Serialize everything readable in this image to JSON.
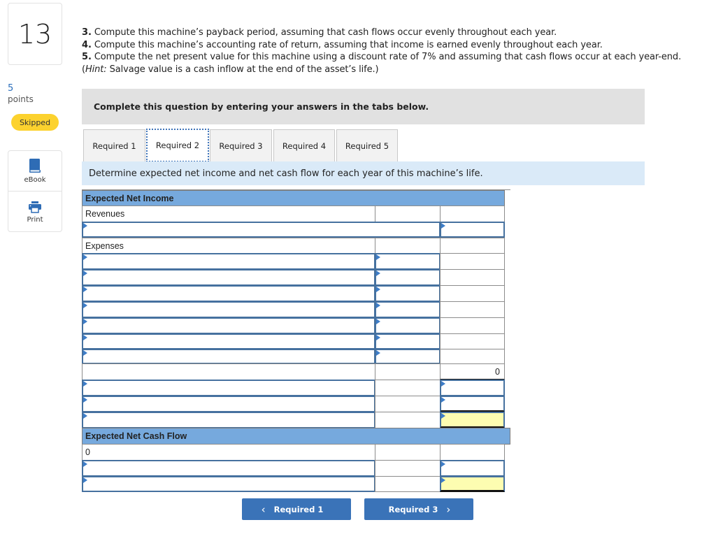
{
  "sidebar": {
    "question_number": "13",
    "points_value": "5",
    "points_label": "points",
    "status_badge": "Skipped",
    "tools": [
      {
        "label": "eBook",
        "icon": "book-icon"
      },
      {
        "label": "Print",
        "icon": "printer-icon"
      }
    ]
  },
  "questions": {
    "q3_num": "3.",
    "q3_text": " Compute this machine’s payback period, assuming that cash flows occur evenly throughout each year.",
    "q4_num": "4.",
    "q4_text": " Compute this machine’s accounting rate of return, assuming that income is earned evenly throughout each year.",
    "q5_num": "5.",
    "q5_text": " Compute the net present value for this machine using a discount rate of 7% and assuming that cash flows occur at each year-end.",
    "hint_open": "(",
    "hint_label": "Hint:",
    "hint_text": " Salvage value is a cash inflow at the end of the asset’s life.)"
  },
  "instructions": "Complete this question by entering your answers in the tabs below.",
  "tabs": [
    {
      "label": "Required 1",
      "active": false
    },
    {
      "label": "Required 2",
      "active": true
    },
    {
      "label": "Required 3",
      "active": false
    },
    {
      "label": "Required 4",
      "active": false
    },
    {
      "label": "Required 5",
      "active": false
    }
  ],
  "tab_description": "Determine expected net income and net cash flow for each year of this machine’s life.",
  "worksheet": {
    "net_income_header": "Expected Net Income",
    "revenues_label": "Revenues",
    "revenues_input": "",
    "revenues_amount": "",
    "expenses_label": "Expenses",
    "expense_rows": [
      {
        "label": "",
        "amount": ""
      },
      {
        "label": "",
        "amount": ""
      },
      {
        "label": "",
        "amount": ""
      },
      {
        "label": "",
        "amount": ""
      },
      {
        "label": "",
        "amount": ""
      },
      {
        "label": "",
        "amount": ""
      },
      {
        "label": "",
        "amount": ""
      }
    ],
    "total_expenses": "0",
    "income_rows": [
      {
        "label": "",
        "amount": ""
      },
      {
        "label": "",
        "amount": ""
      },
      {
        "label": "",
        "amount": ""
      }
    ],
    "cash_flow_header": "Expected Net Cash Flow",
    "cash_flow_start": "0",
    "cash_flow_rows": [
      {
        "label": "",
        "amount": ""
      },
      {
        "label": "",
        "amount": ""
      }
    ]
  },
  "navigation": {
    "prev_label": "Required 1",
    "next_label": "Required 3",
    "prev_icon": "chevron-left-icon",
    "next_icon": "chevron-right-icon"
  }
}
